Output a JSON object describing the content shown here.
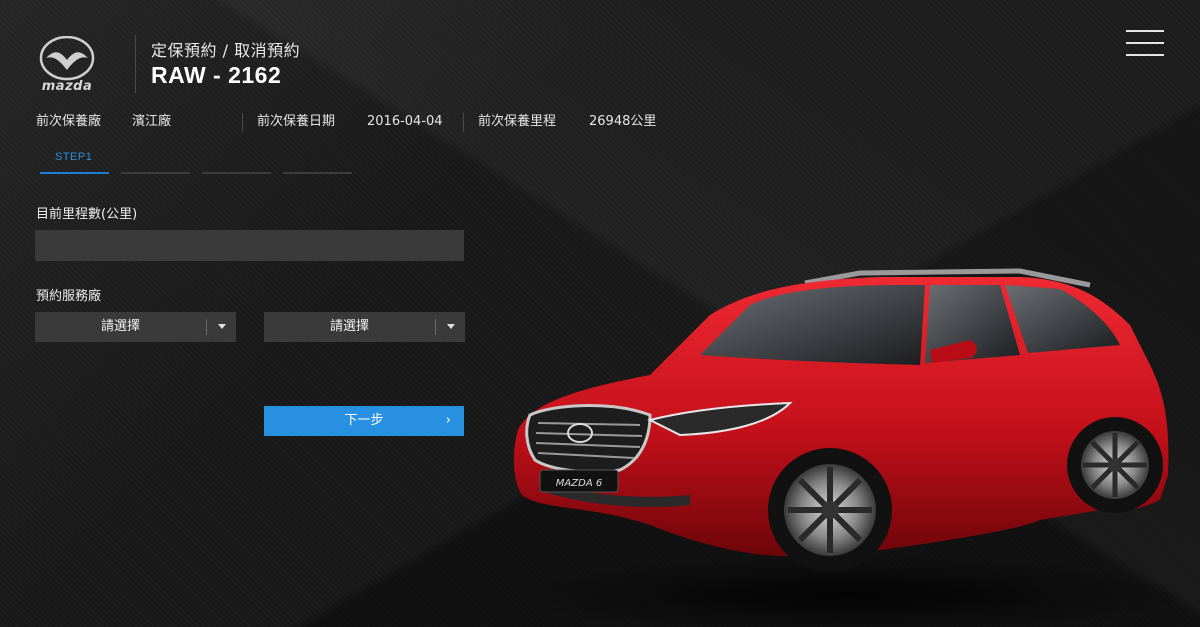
{
  "brand": {
    "logo_text": "mazda",
    "logo_icon": "mazda-wing-logo"
  },
  "header": {
    "subtitle": "定保預約 / 取消預約",
    "plate": "RAW - 2162",
    "menu_icon": "hamburger-menu-icon"
  },
  "info": {
    "last_dealer_label": "前次保養廠",
    "last_dealer_value": "濱江廠",
    "last_date_label": "前次保養日期",
    "last_date_value": "2016-04-04",
    "last_mileage_label": "前次保養里程",
    "last_mileage_value": "26948公里"
  },
  "steps": {
    "current_label": "STEP1",
    "current": 1,
    "total": 4,
    "accent": "#1f7ed1"
  },
  "form": {
    "mileage_label": "目前里程數(公里)",
    "mileage_value": "",
    "dealer_label": "預約服務廠",
    "select_1": "請選擇",
    "select_2": "請選擇",
    "next_label": "下一步",
    "next_chevron": "›",
    "button_color": "#2790e0"
  },
  "car": {
    "badge": "MAZDA 6",
    "color": "#c8101c"
  }
}
